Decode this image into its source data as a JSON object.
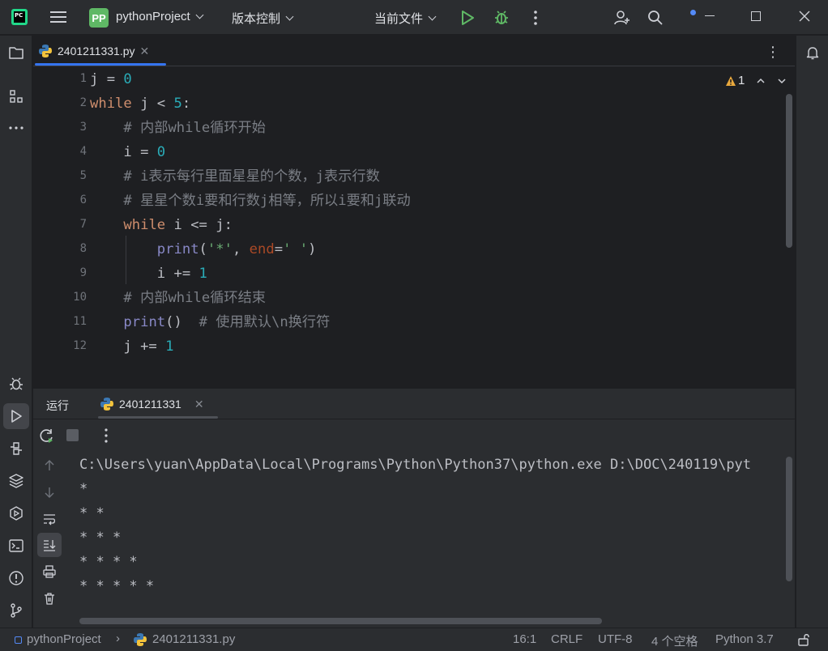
{
  "titlebar": {
    "project_badge": "PP",
    "project_name": "pythonProject",
    "vcs_label": "版本控制",
    "run_config": "当前文件",
    "app_logo": "PC"
  },
  "editor": {
    "tab_label": "2401211331.py",
    "inspection_count": "1",
    "line_numbers": [
      "1",
      "2",
      "3",
      "4",
      "5",
      "6",
      "7",
      "8",
      "9",
      "10",
      "11",
      "12"
    ]
  },
  "run_panel": {
    "title": "运行",
    "tab_label": "2401211331",
    "output": [
      "C:\\Users\\yuan\\AppData\\Local\\Programs\\Python\\Python37\\python.exe D:\\DOC\\240119\\pyt",
      "*",
      "* *",
      "* * *",
      "* * * *",
      "* * * * *"
    ]
  },
  "statusbar": {
    "project": "pythonProject",
    "file": "2401211331.py",
    "position": "16:1",
    "line_sep": "CRLF",
    "encoding": "UTF-8",
    "indent": "4 个空格",
    "interpreter": "Python 3.7"
  },
  "colors": {
    "accent": "#3574f0",
    "run_green": "#5fb865",
    "bg": "#1e1f22",
    "panel": "#2b2d30"
  }
}
